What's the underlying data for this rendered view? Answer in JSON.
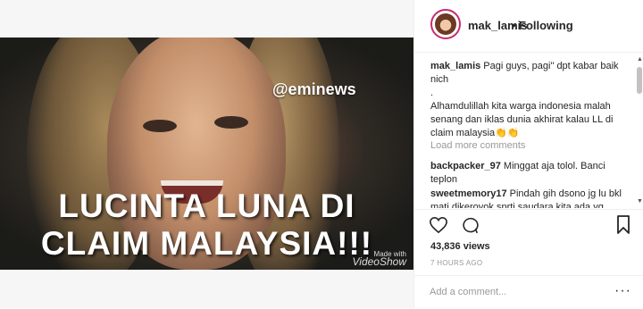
{
  "post": {
    "username": "mak_lamis",
    "separator": "•",
    "follow_label": "Following"
  },
  "media": {
    "watermark": "@eminews",
    "caption_line1": "LUCINTA LUNA DI",
    "caption_line2": "CLAIM MALAYSIA!!!",
    "madewith_small": "Made with",
    "madewith_brand": "VideoShow"
  },
  "comments": [
    {
      "user": "mak_lamis",
      "text": "Pagi guys, pagi\" dpt kabar baik nich"
    },
    {
      "user": "",
      "text": "."
    },
    {
      "user": "",
      "text": "Alhamdulillah kita warga indonesia malah senang dan iklas dunia akhirat kalau LL di claim malaysia👏👏"
    },
    {
      "user": "backpacker_97",
      "text": "Minggat aja tolol. Banci teplon"
    },
    {
      "user": "sweetmemory17",
      "text": "Pindah gih dsono jg lu bkl mati dikeroyok sprti saudara kita ada yg"
    }
  ],
  "load_more": "Load more comments",
  "stats": {
    "views": "43,836 views",
    "time_ago": "7 HOURS AGO"
  },
  "add_comment": {
    "placeholder": "Add a comment...",
    "options_icon": "···"
  },
  "icons": {
    "like": "heart-icon",
    "comment": "comment-icon",
    "save": "bookmark-icon"
  },
  "colors": {
    "avatar_ring": "#c92b6c",
    "muted_text": "#999999",
    "text": "#262626"
  }
}
